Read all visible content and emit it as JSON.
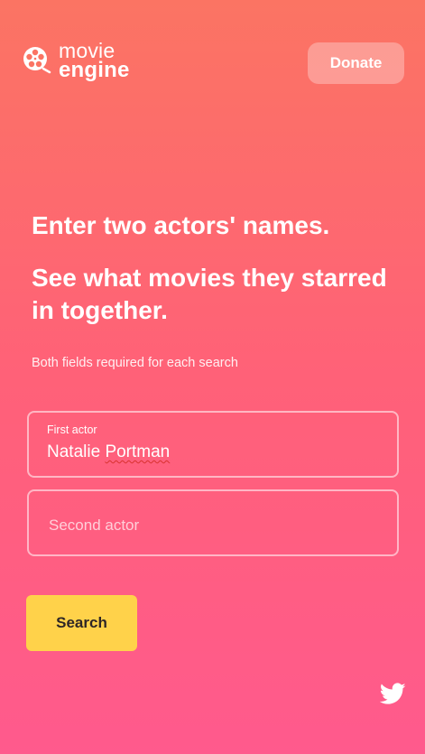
{
  "brand": {
    "line1": "movie",
    "line2": "engine",
    "icon": "film-reel-icon"
  },
  "header": {
    "donate_label": "Donate"
  },
  "hero": {
    "headline": "Enter two actors' names.",
    "subheadline": "See what movies they starred in together.",
    "hint": "Both fields required for each search"
  },
  "form": {
    "first_actor": {
      "label": "First actor",
      "value_first": "Natalie",
      "value_last": "Portman"
    },
    "second_actor": {
      "placeholder": "Second actor",
      "value": ""
    },
    "search_label": "Search"
  },
  "footer": {
    "social_icon": "twitter-icon"
  },
  "colors": {
    "gradient_top": "#fb7463",
    "gradient_bottom": "#ff5a8d",
    "search_button": "#ffd24a"
  }
}
